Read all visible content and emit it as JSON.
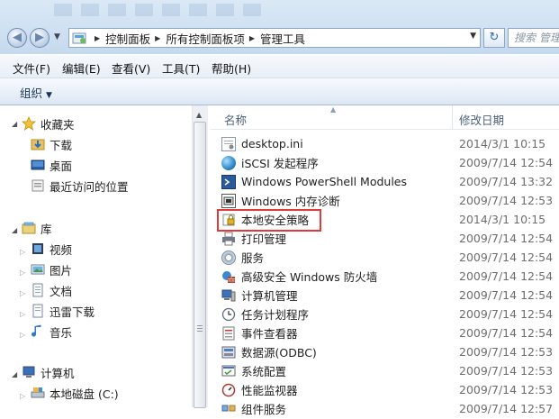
{
  "address": {
    "crumbs": [
      "控制面板",
      "所有控制面板项",
      "管理工具"
    ],
    "search_placeholder": "搜索 管理工具"
  },
  "menu": [
    "文件(F)",
    "编辑(E)",
    "查看(V)",
    "工具(T)",
    "帮助(H)"
  ],
  "toolbar": {
    "organize_label": "组织"
  },
  "nav": {
    "favorites": {
      "label": "收藏夹",
      "items": [
        "下载",
        "桌面",
        "最近访问的位置"
      ]
    },
    "libraries": {
      "label": "库",
      "items": [
        "视频",
        "图片",
        "文档",
        "迅雷下载",
        "音乐"
      ]
    },
    "computer": {
      "label": "计算机",
      "items": [
        "本地磁盘 (C:)"
      ]
    }
  },
  "columns": {
    "name": "名称",
    "modified": "修改日期"
  },
  "files": [
    {
      "name": "desktop.ini",
      "date": "2014/3/1 10:15",
      "icon": "ini-file-icon"
    },
    {
      "name": "iSCSI 发起程序",
      "date": "2009/7/14 12:54",
      "icon": "iscsi-globe-icon"
    },
    {
      "name": "Windows PowerShell Modules",
      "date": "2009/7/14 13:32",
      "icon": "powershell-icon"
    },
    {
      "name": "Windows 内存诊断",
      "date": "2009/7/14 12:53",
      "icon": "memory-diagnostic-icon"
    },
    {
      "name": "本地安全策略",
      "date": "2014/3/1 10:15",
      "icon": "security-policy-icon"
    },
    {
      "name": "打印管理",
      "date": "2009/7/14 12:54",
      "icon": "print-management-icon"
    },
    {
      "name": "服务",
      "date": "2009/7/14 12:54",
      "icon": "services-gear-icon"
    },
    {
      "name": "高级安全 Windows 防火墙",
      "date": "2009/7/14 12:54",
      "icon": "firewall-icon"
    },
    {
      "name": "计算机管理",
      "date": "2009/7/14 12:54",
      "icon": "computer-management-icon"
    },
    {
      "name": "任务计划程序",
      "date": "2009/7/14 12:54",
      "icon": "task-scheduler-icon"
    },
    {
      "name": "事件查看器",
      "date": "2009/7/14 12:54",
      "icon": "event-viewer-icon"
    },
    {
      "name": "数据源(ODBC)",
      "date": "2009/7/14 12:53",
      "icon": "odbc-icon"
    },
    {
      "name": "系统配置",
      "date": "2009/7/14 12:53",
      "icon": "system-config-icon"
    },
    {
      "name": "性能监视器",
      "date": "2009/7/14 12:53",
      "icon": "performance-monitor-icon"
    },
    {
      "name": "组件服务",
      "date": "2009/7/14 12:57",
      "icon": "component-services-icon"
    }
  ],
  "colors": {
    "highlight": "#e03a3a",
    "header_text": "#4c607a"
  }
}
